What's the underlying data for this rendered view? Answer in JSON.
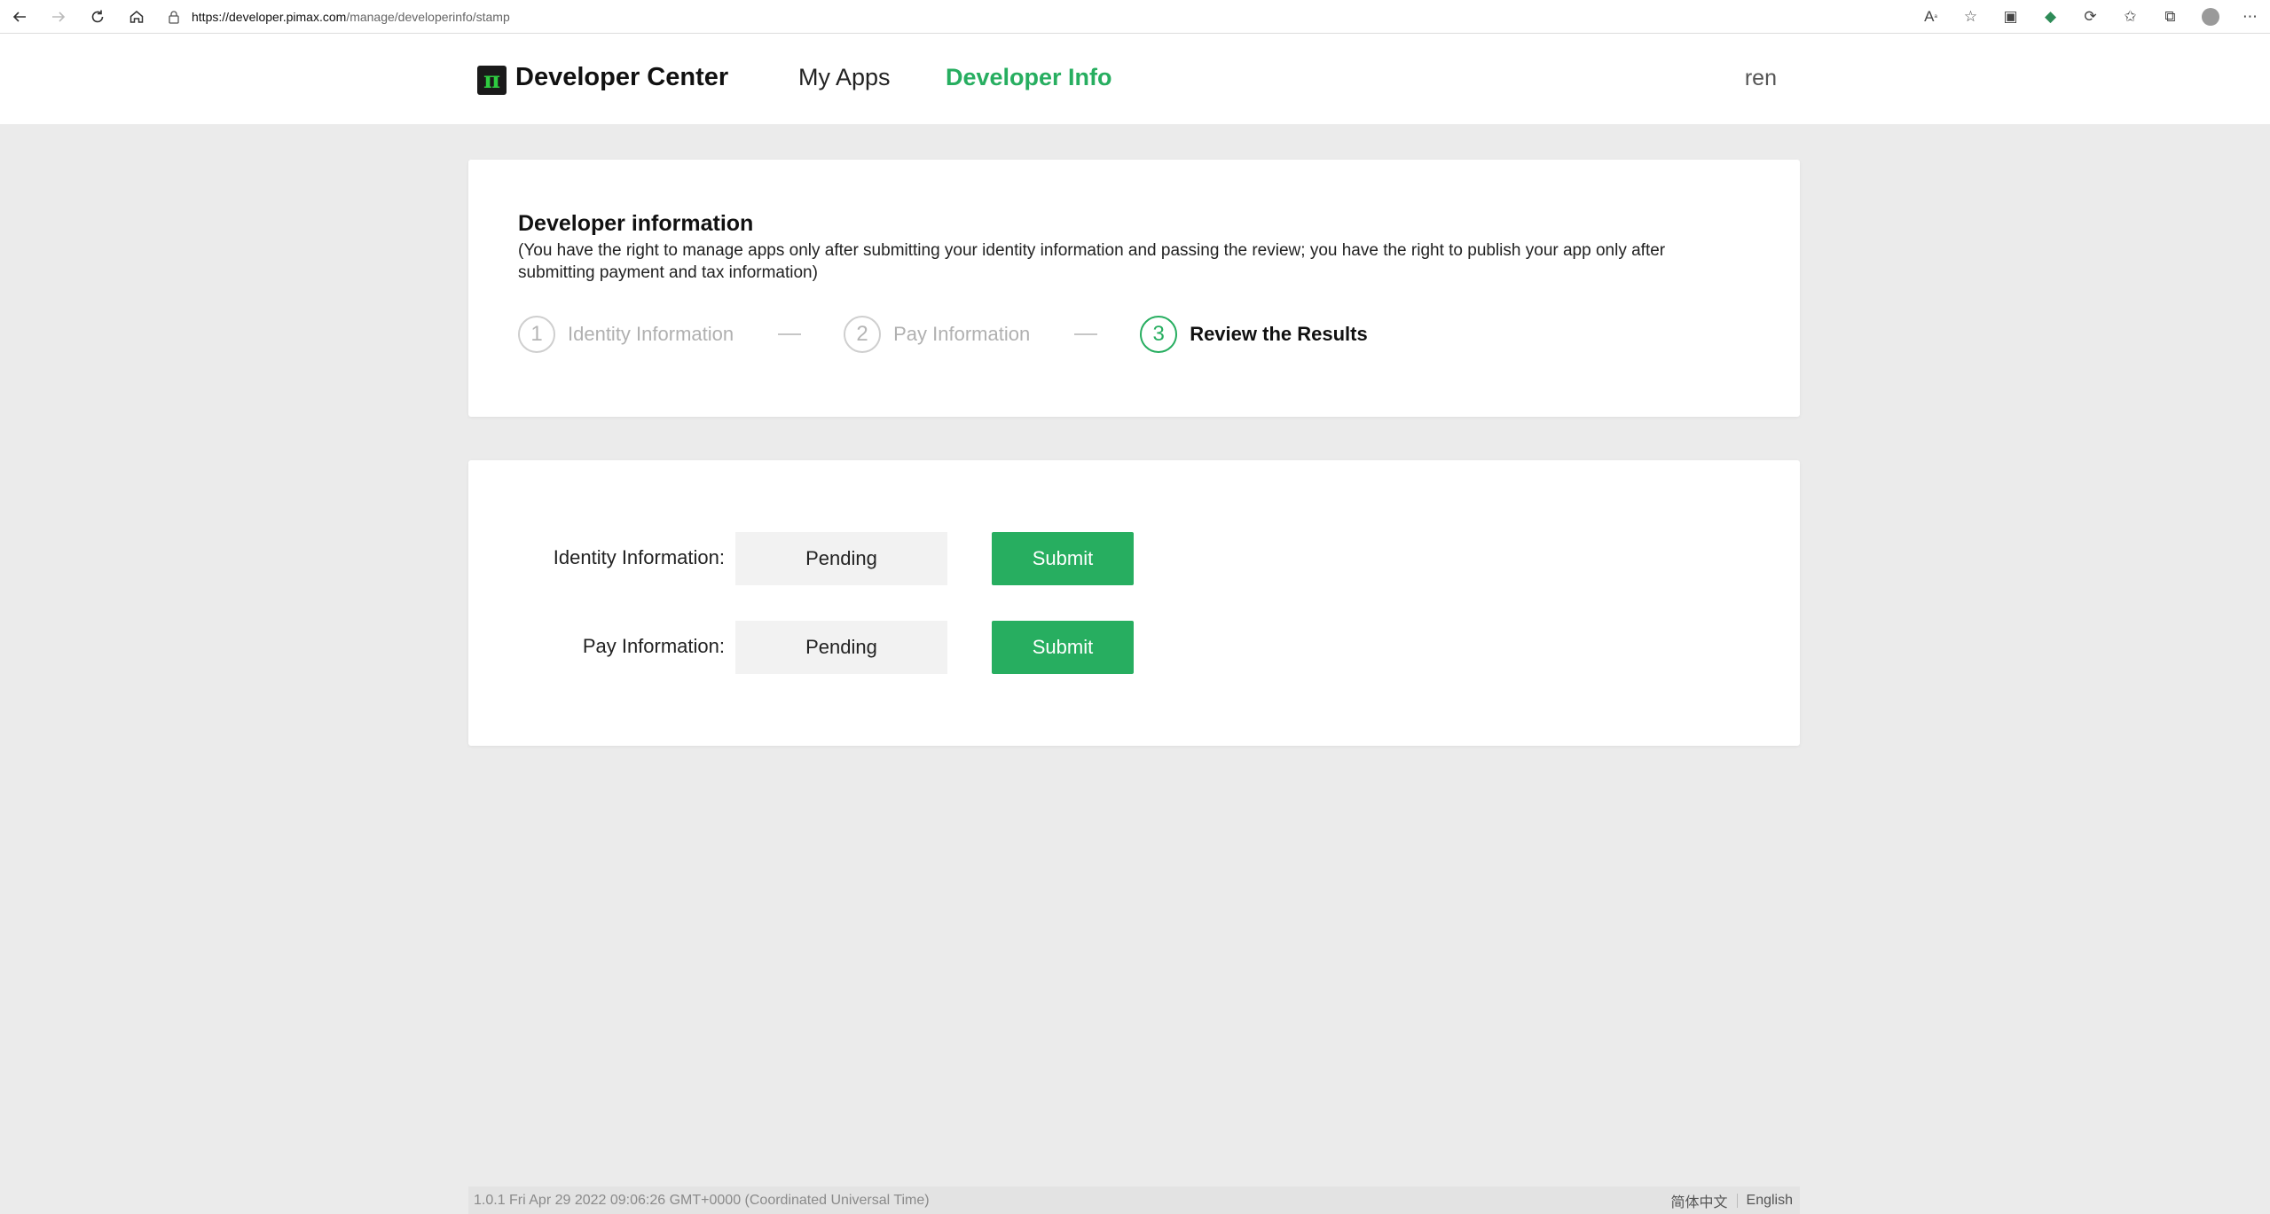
{
  "browser": {
    "url_host": "https://developer.pimax.com",
    "url_path": "/manage/developerinfo/stamp"
  },
  "header": {
    "logo_glyph": "π",
    "brand": "Developer Center",
    "nav": [
      {
        "label": "My Apps",
        "active": false
      },
      {
        "label": "Developer Info",
        "active": true
      }
    ],
    "user": "ren",
    "accent_color": "#27ae60"
  },
  "info": {
    "title": "Developer information",
    "description": "(You have the right to manage apps only after submitting your identity information and passing the review; you have the right to publish your app only after submitting payment and tax information)",
    "steps": [
      {
        "number": "1",
        "label": "Identity Information",
        "state": "inactive"
      },
      {
        "number": "2",
        "label": "Pay Information",
        "state": "inactive"
      },
      {
        "number": "3",
        "label": "Review the Results",
        "state": "current"
      }
    ]
  },
  "status": {
    "rows": [
      {
        "label": "Identity Information:",
        "status": "Pending",
        "button": "Submit"
      },
      {
        "label": "Pay Information:",
        "status": "Pending",
        "button": "Submit"
      }
    ]
  },
  "footer": {
    "version": "1.0.1 Fri Apr 29 2022 09:06:26 GMT+0000 (Coordinated Universal Time)",
    "languages": [
      "简体中文",
      "English"
    ]
  }
}
